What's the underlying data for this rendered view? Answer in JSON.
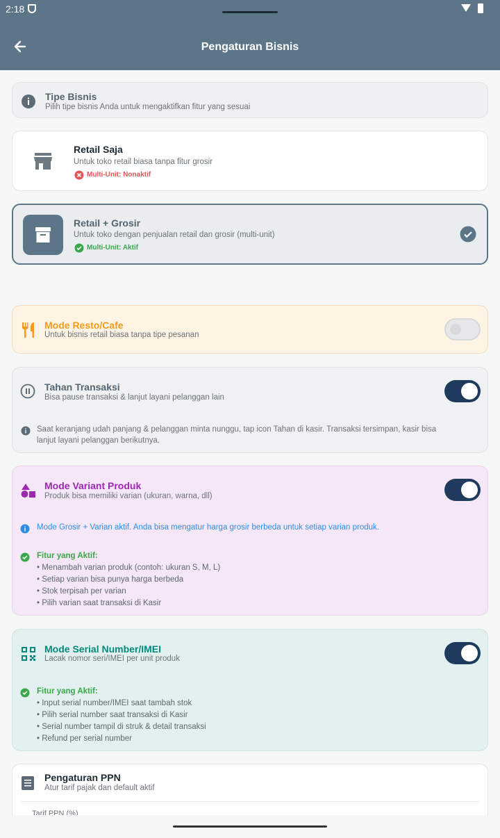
{
  "status": {
    "time": "2:18"
  },
  "appbar": {
    "title": "Pengaturan Bisnis"
  },
  "tipe": {
    "title": "Tipe Bisnis",
    "subtitle": "Pilih tipe bisnis Anda untuk mengaktifkan fitur yang sesuai"
  },
  "options": [
    {
      "title": "Retail Saja",
      "subtitle": "Untuk toko retail biasa tanpa fitur grosir",
      "badge": "Multi-Unit: Nonaktif"
    },
    {
      "title": "Retail + Grosir",
      "subtitle": "Untuk toko dengan penjualan retail dan grosir (multi-unit)",
      "badge": "Multi-Unit: Aktif"
    }
  ],
  "resto": {
    "title": "Mode Resto/Cafe",
    "subtitle": "Untuk bisnis retail biasa tanpa tipe pesanan",
    "enabled": false
  },
  "tahan": {
    "title": "Tahan Transaksi",
    "subtitle": "Bisa pause transaksi & lanjut layani pelanggan lain",
    "enabled": true,
    "info_line1": "Saat keranjang udah panjang & pelanggan minta nunggu, tap icon Tahan di kasir. Transaksi tersimpan, kasir bisa",
    "info_line2": "lanjut layani pelanggan berikutnya."
  },
  "variant": {
    "title": "Mode Variant Produk",
    "subtitle": "Produk bisa memiliki varian (ukuran, warna, dll)",
    "enabled": true,
    "info": "Mode Grosir + Varian aktif. Anda bisa mengatur harga grosir berbeda untuk setiap varian produk.",
    "features_title": "Fitur yang Aktif:",
    "features": [
      "• Menambah varian produk (contoh: ukuran S, M, L)",
      "• Setiap varian bisa punya harga berbeda",
      "• Stok terpisah per varian",
      "• Pilih varian saat transaksi di Kasir"
    ]
  },
  "serial": {
    "title": "Mode Serial Number/IMEI",
    "subtitle": "Lacak nomor seri/IMEI per unit produk",
    "enabled": true,
    "features_title": "Fitur yang Aktif:",
    "features": [
      "• Input serial number/IMEI saat tambah stok",
      "• Pilih serial number saat transaksi di Kasir",
      "• Serial number tampil di struk & detail transaksi",
      "• Refund per serial number"
    ]
  },
  "ppn": {
    "title": "Pengaturan PPN",
    "subtitle": "Atur tarif pajak dan default aktif",
    "field_label": "Tarif PPN (%)"
  },
  "colors": {
    "primary": "#5c7688",
    "toggle_on": "#1e3a5c",
    "resto_accent": "#f29b1c",
    "variant_accent": "#9c27b0",
    "serial_accent": "#00897b",
    "success": "#3aa84a",
    "error": "#e25555",
    "info": "#2d8de6"
  }
}
